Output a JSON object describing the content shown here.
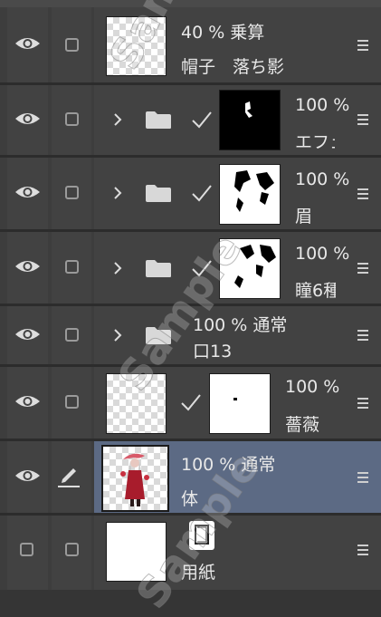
{
  "layers": [
    {
      "line1": "40 % 乗算",
      "line2": "帽子　落ち影"
    },
    {
      "line1": "100 %",
      "line2": "エフェ"
    },
    {
      "line1": "100 %",
      "line2": "眉"
    },
    {
      "line1": "100 %",
      "line2": "瞳6種"
    },
    {
      "line1": "100 % 通常",
      "line2": "口13"
    },
    {
      "line1": "100 %",
      "line2": "薔薇"
    },
    {
      "line1": "100 % 通常",
      "line2": "体"
    },
    {
      "line1": "",
      "line2": "用紙"
    }
  ],
  "watermark": "Sample",
  "colors": {
    "selected_row": "#5c6a84",
    "panel": "#424242",
    "background": "#353535"
  }
}
